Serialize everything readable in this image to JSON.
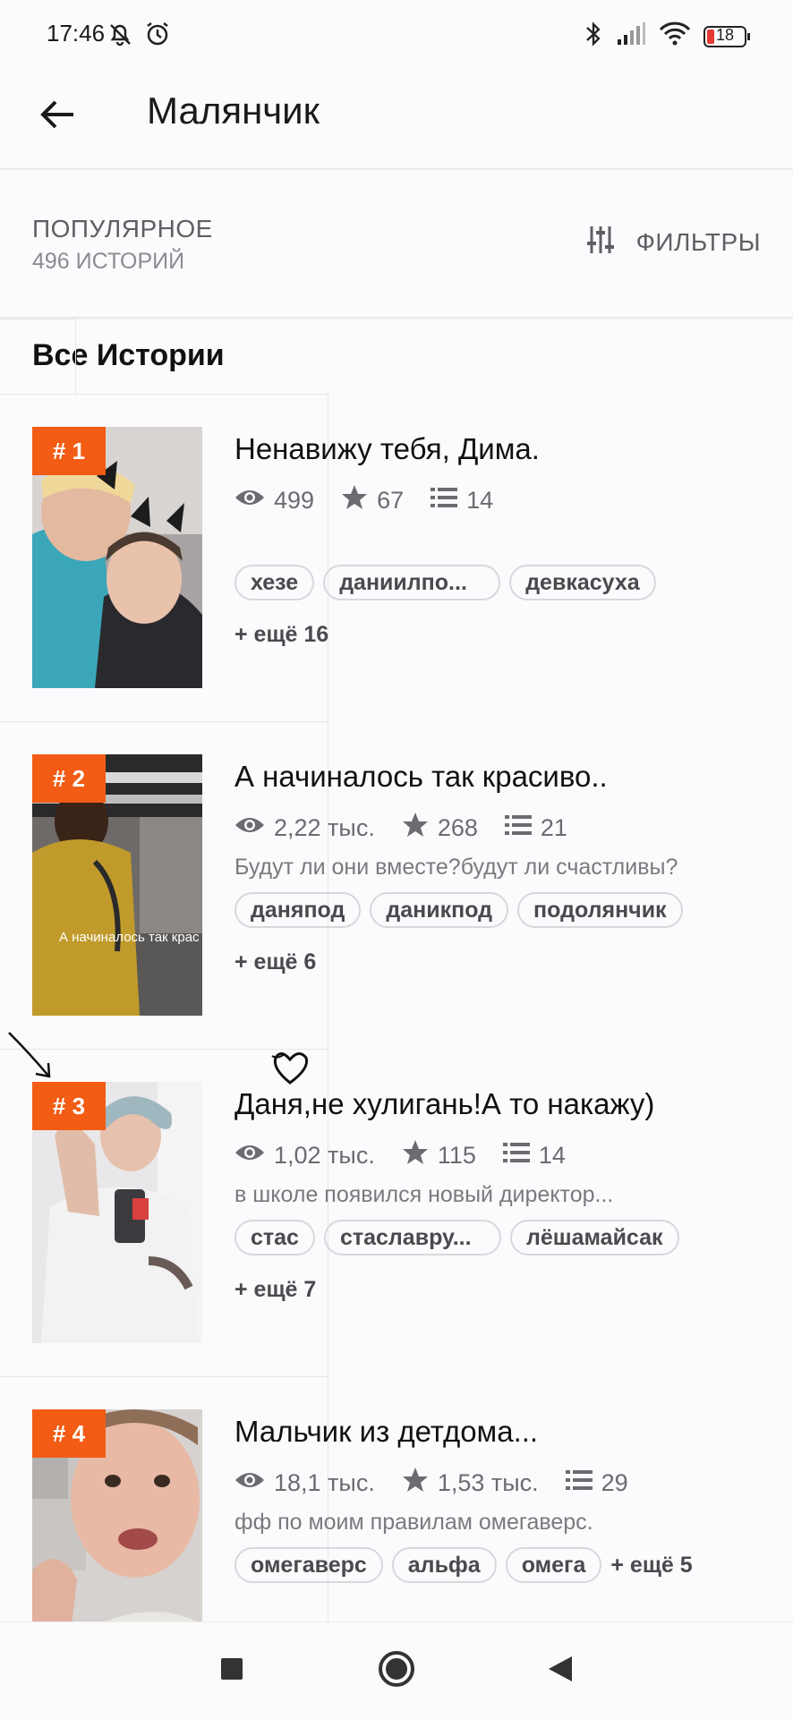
{
  "status": {
    "time": "17:46",
    "battery": "18"
  },
  "header": {
    "title": "Малянчик"
  },
  "filters": {
    "sort_label": "ПОПУЛЯРНОЕ",
    "count": "496 ИСТОРИЙ",
    "filter_label": "ФИЛЬТРЫ"
  },
  "section": {
    "title": "Все Истории"
  },
  "stories": [
    {
      "rank": "# 1",
      "title": "Ненавижу тебя, Дима.",
      "views": "499",
      "stars": "67",
      "chapters": "14",
      "description": "",
      "tags": [
        "хезе",
        "даниилпо...",
        "девкасуха"
      ],
      "more": "+ ещё 16"
    },
    {
      "rank": "# 2",
      "title": "А начиналось так красиво..",
      "views": "2,22 тыс.",
      "stars": "268",
      "chapters": "21",
      "description": "Будут ли они вместе?будут ли счастливы?",
      "tags": [
        "даняпод",
        "даникпод",
        "подолянчик"
      ],
      "more": "+ ещё 6",
      "cover_caption": "А начиналось так крас"
    },
    {
      "rank": "# 3",
      "title": "Даня,не хулигань!А то накажу)",
      "views": "1,02 тыс.",
      "stars": "115",
      "chapters": "14",
      "description": "в школе появился новый директор...",
      "tags": [
        "стас",
        "стаславру...",
        "лёшамайсак"
      ],
      "more": "+ ещё 7"
    },
    {
      "rank": "# 4",
      "title": "Мальчик из детдома...",
      "views": "18,1 тыс.",
      "stars": "1,53 тыс.",
      "chapters": "29",
      "description": "фф по моим правилам омегаверс.",
      "tags": [
        "омегаверс",
        "альфа",
        "омега"
      ],
      "more": "+ ещё 5"
    }
  ],
  "icons": {
    "back": "arrow-left-icon",
    "filter": "sliders-icon",
    "views": "eye-icon",
    "stars": "star-icon",
    "chapters": "list-icon",
    "nav_recent": "square-icon",
    "nav_home": "circle-icon",
    "nav_back": "triangle-back-icon"
  },
  "colors": {
    "accent": "#f25c14",
    "text_primary": "#111111",
    "text_secondary": "#6b6b70",
    "background": "#fbfafc"
  }
}
